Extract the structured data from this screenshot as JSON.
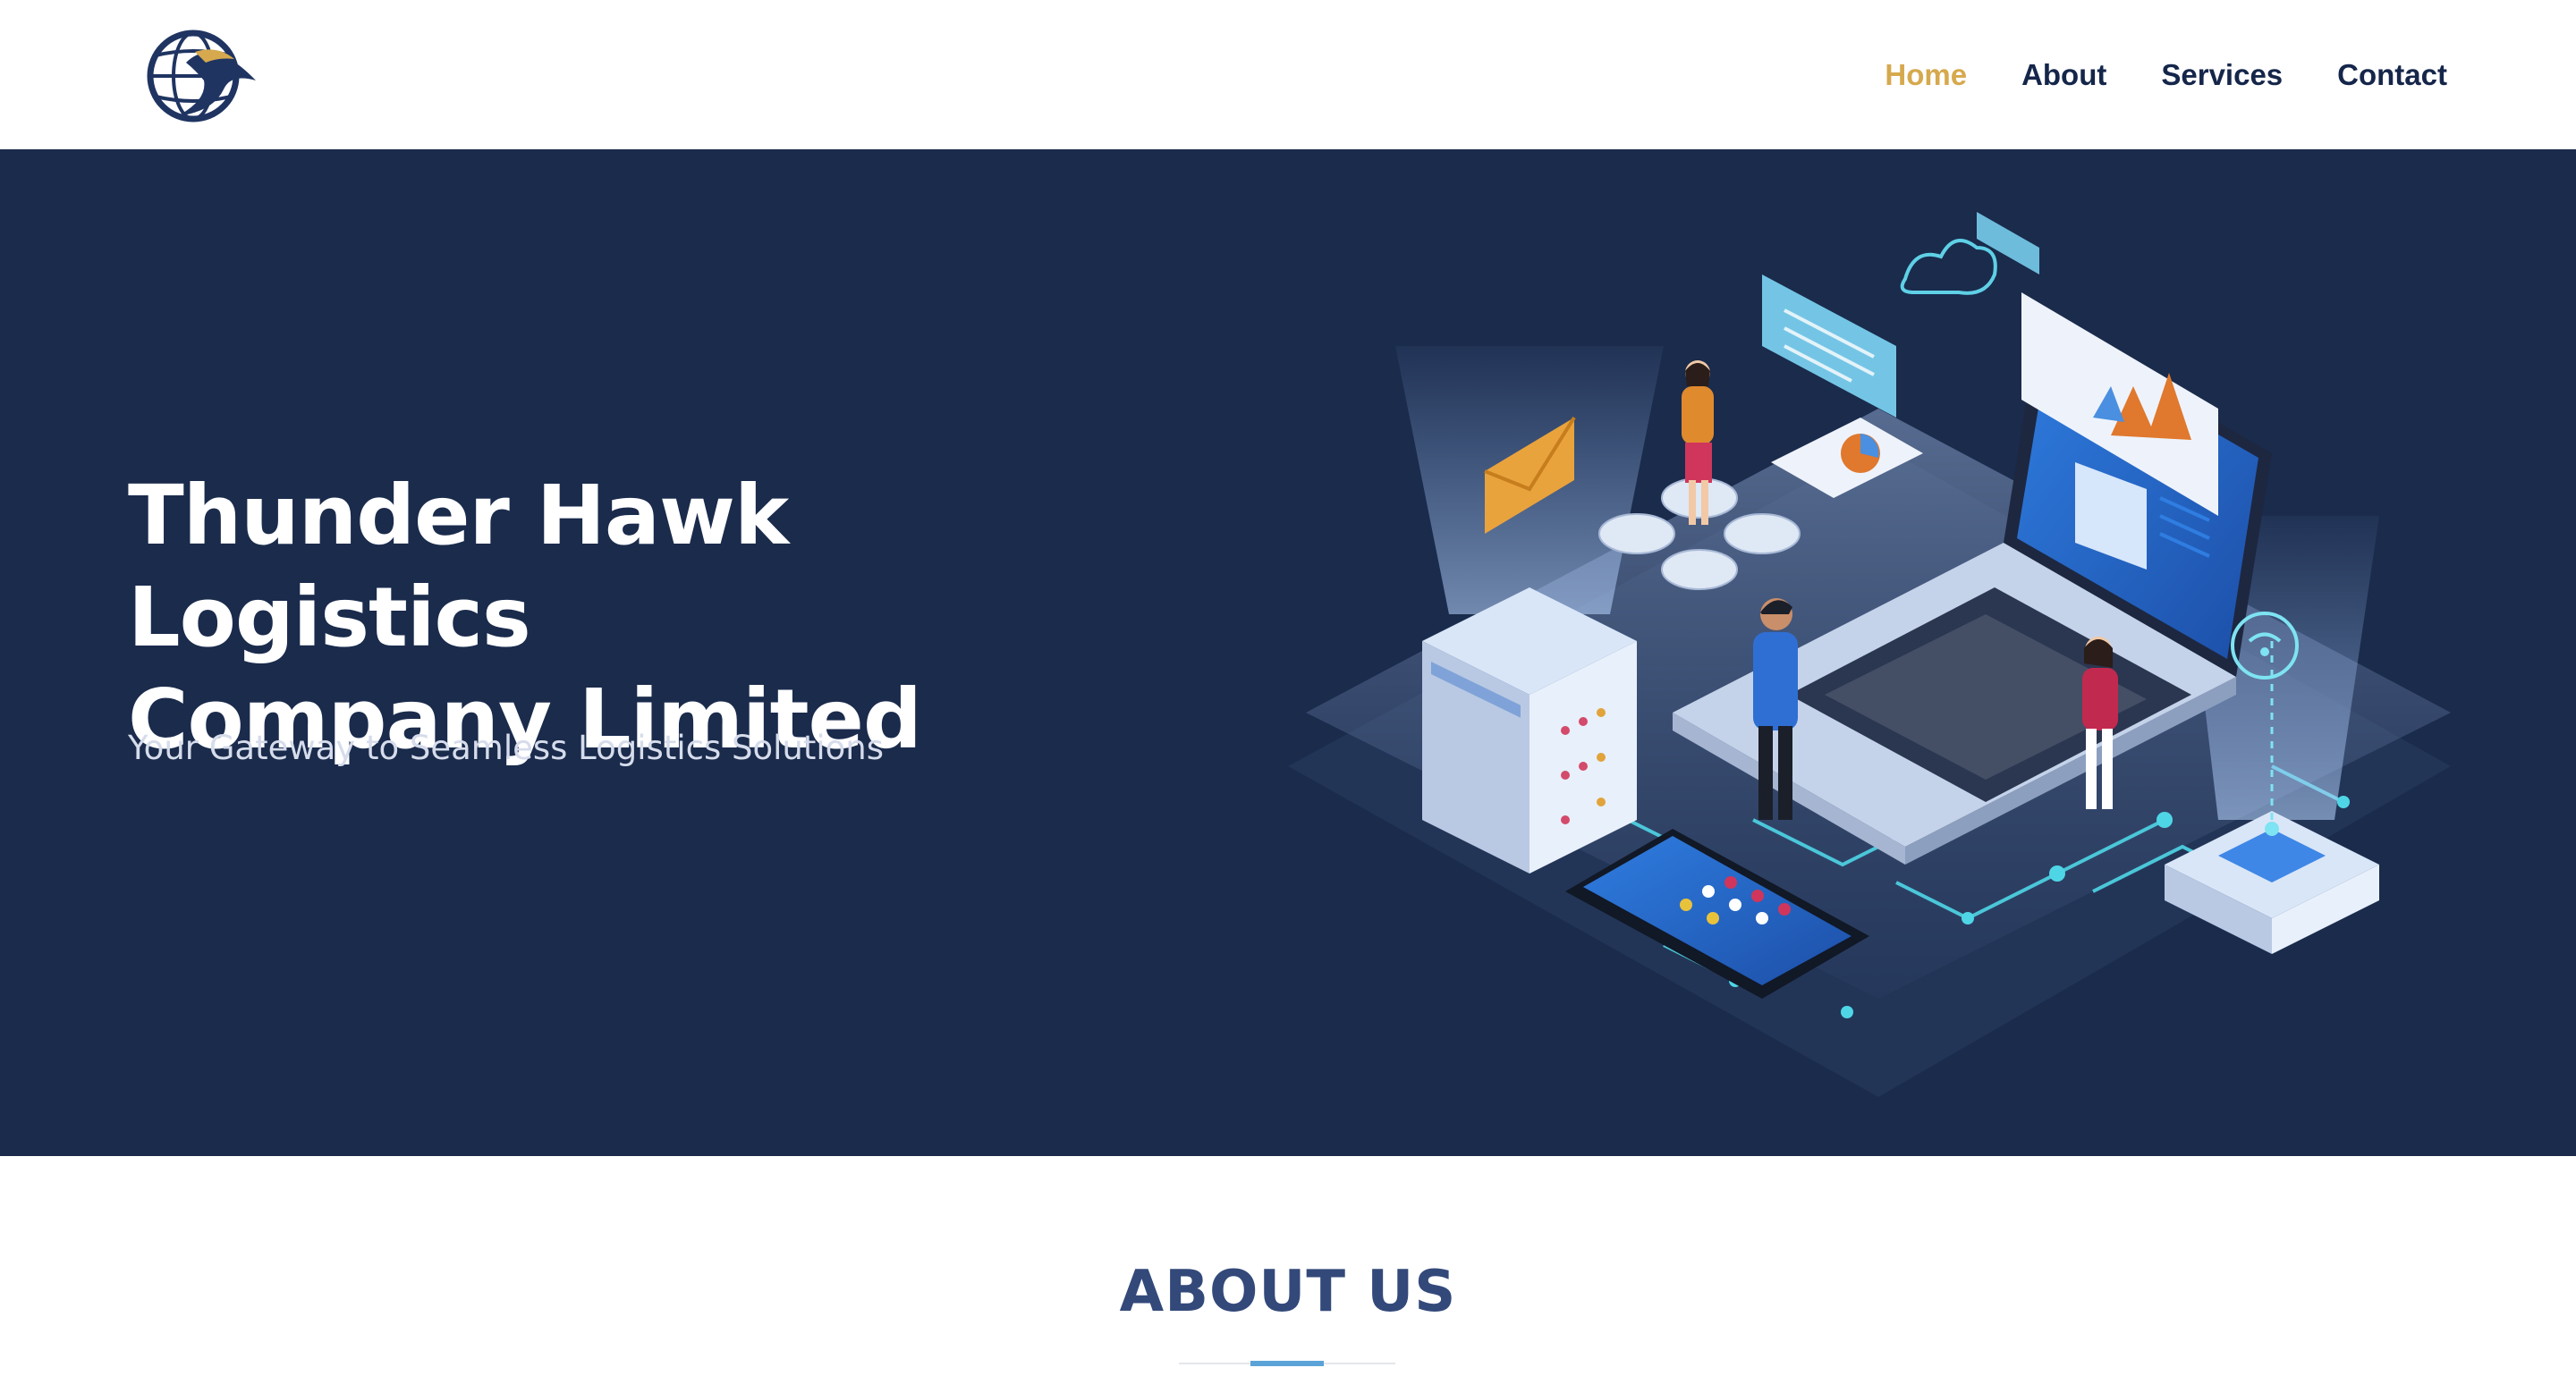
{
  "header": {
    "logo_icon": "hawk-globe-logo",
    "nav": [
      {
        "label": "Home",
        "active": true
      },
      {
        "label": "About",
        "active": false
      },
      {
        "label": "Services",
        "active": false
      },
      {
        "label": "Contact",
        "active": false
      }
    ]
  },
  "hero": {
    "title_line1": "Thunder Hawk Logistics",
    "title_line2": "Company Limited",
    "subtitle": "Your Gateway to Seamless Logistics Solutions",
    "illustration": "isometric-technology-illustration"
  },
  "about": {
    "title": "ABOUT US"
  },
  "colors": {
    "brand_navy": "#1a2b4c",
    "accent_gold": "#d6a94e",
    "nav_text": "#15264a",
    "about_title": "#33497a",
    "accent_blue": "#5aa3d8"
  }
}
